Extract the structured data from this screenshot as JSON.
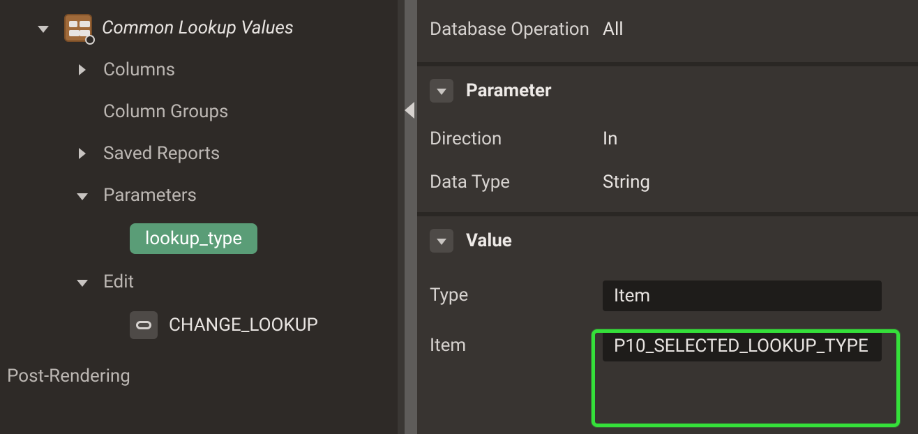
{
  "sidebar": {
    "rootLabel": "Common Lookup Values",
    "columnsLabel": "Columns",
    "columnGroupsLabel": "Column Groups",
    "savedReportsLabel": "Saved Reports",
    "parametersLabel": "Parameters",
    "parameterItem": "lookup_type",
    "editLabel": "Edit",
    "editItem": "CHANGE_LOOKUP",
    "postRenderingLabel": "Post-Rendering"
  },
  "properties": {
    "databaseOperationLabel": "Database Operation",
    "databaseOperationValue": "All",
    "parameterGroupLabel": "Parameter",
    "directionLabel": "Direction",
    "directionValue": "In",
    "dataTypeLabel": "Data Type",
    "dataTypeValue": "String",
    "valueGroupLabel": "Value",
    "typeLabel": "Type",
    "typeValue": "Item",
    "itemLabel": "Item",
    "itemValue": "P10_SELECTED_LOOKUP_TYPE"
  }
}
